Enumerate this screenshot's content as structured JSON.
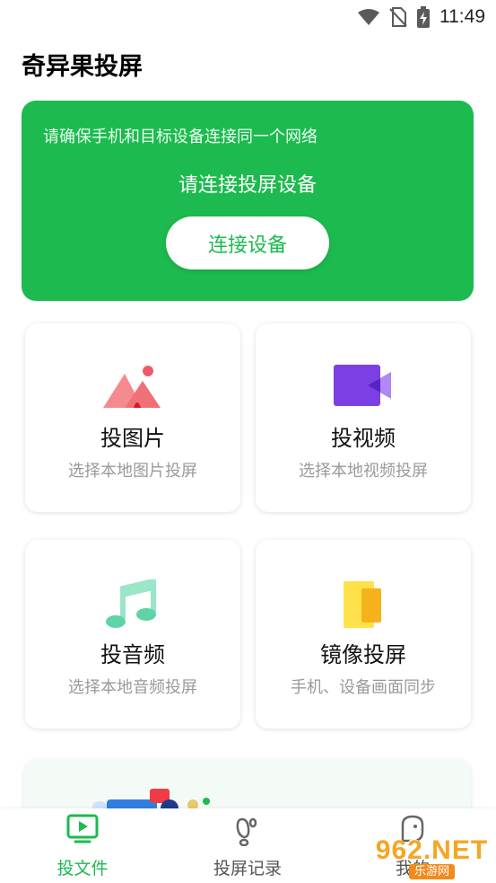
{
  "status_bar": {
    "time": "11:49",
    "icons": [
      "wifi-icon",
      "no-sim-icon",
      "battery-charging-icon"
    ]
  },
  "app": {
    "title": "奇异果投屏"
  },
  "connect_card": {
    "hint": "请确保手机和目标设备连接同一个网络",
    "status": "请连接投屏设备",
    "button_label": "连接设备",
    "color": "#1dba4f"
  },
  "features": [
    {
      "title": "投图片",
      "subtitle": "选择本地图片投屏",
      "icon": "image-icon"
    },
    {
      "title": "投视频",
      "subtitle": "选择本地视频投屏",
      "icon": "video-icon"
    },
    {
      "title": "投音频",
      "subtitle": "选择本地音频投屏",
      "icon": "music-icon"
    },
    {
      "title": "镜像投屏",
      "subtitle": "手机、设备画面同步",
      "icon": "mirror-icon"
    }
  ],
  "bottom_nav": {
    "items": [
      {
        "label": "投文件",
        "icon": "cast-file-icon",
        "active": true
      },
      {
        "label": "投屏记录",
        "icon": "footprint-icon",
        "active": false
      },
      {
        "label": "我的",
        "icon": "profile-icon",
        "active": false
      }
    ],
    "active_color": "#1dba4f",
    "inactive_color": "#555555"
  },
  "watermark": {
    "logo": "962.NET",
    "subtitle": "乐游网"
  }
}
